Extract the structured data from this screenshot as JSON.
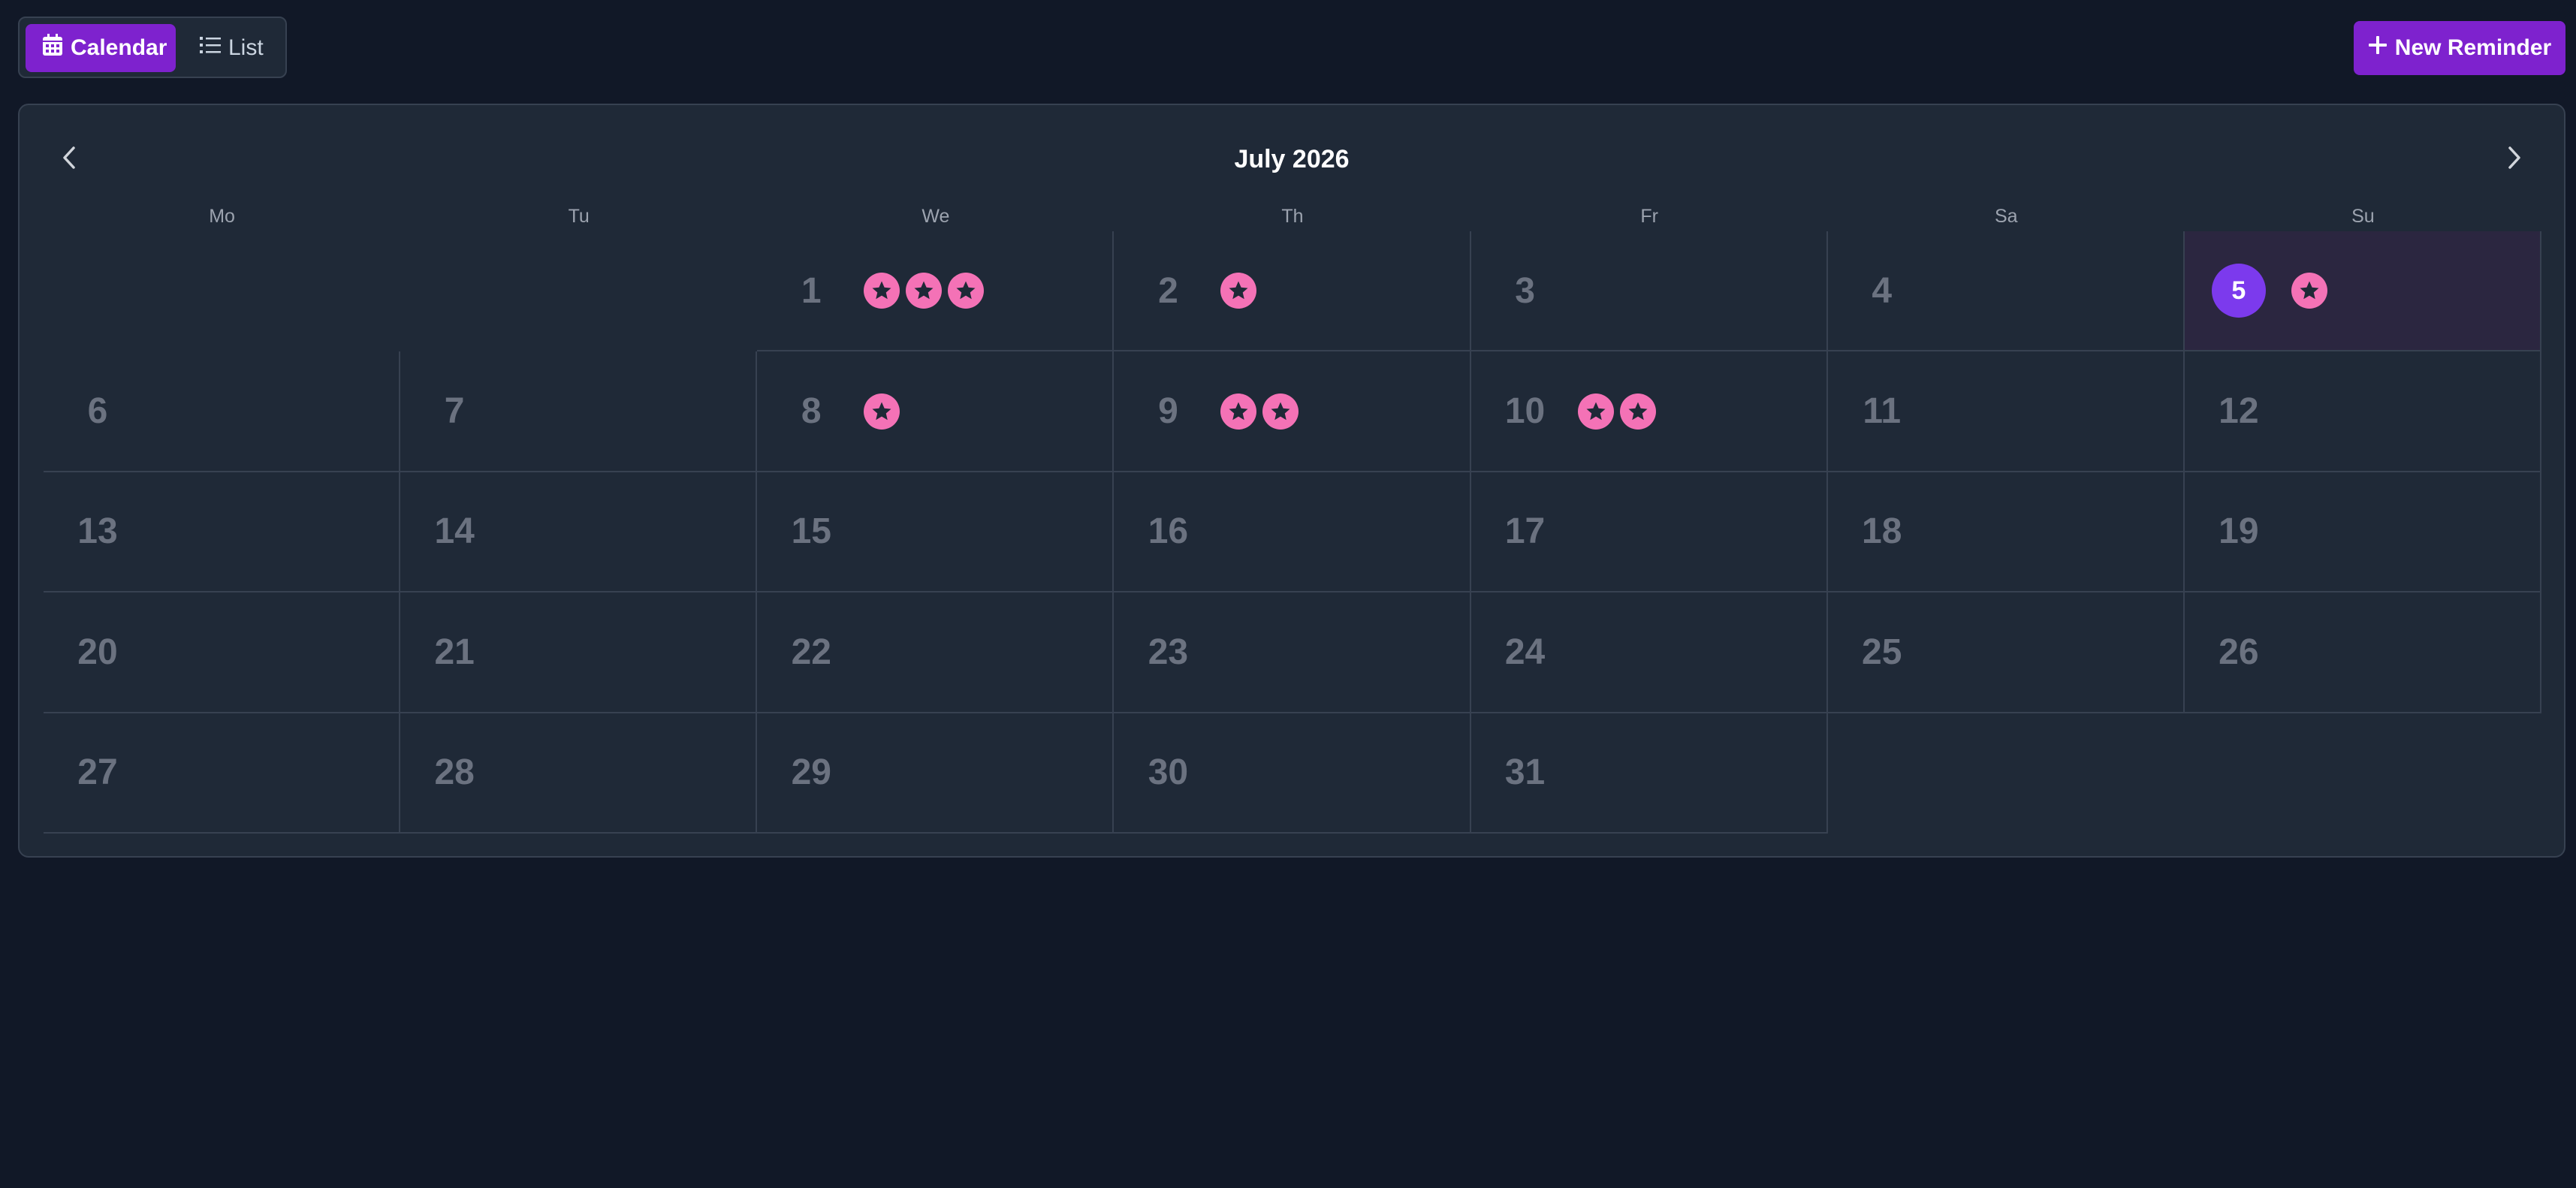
{
  "toolbar": {
    "calendar_label": "Calendar",
    "list_label": "List",
    "new_label": "New Reminder"
  },
  "calendar": {
    "month_title": "July 2026",
    "weekdays": [
      "Mo",
      "Tu",
      "We",
      "Th",
      "Fr",
      "Sa",
      "Su"
    ],
    "leading_blank_days": 2,
    "today": 5,
    "days": [
      {
        "day": "1",
        "reminders": 3
      },
      {
        "day": "2",
        "reminders": 1
      },
      {
        "day": "3",
        "reminders": 0
      },
      {
        "day": "4",
        "reminders": 0
      },
      {
        "day": "5",
        "reminders": 1
      },
      {
        "day": "6",
        "reminders": 0
      },
      {
        "day": "7",
        "reminders": 0
      },
      {
        "day": "8",
        "reminders": 1
      },
      {
        "day": "9",
        "reminders": 2
      },
      {
        "day": "10",
        "reminders": 2
      },
      {
        "day": "11",
        "reminders": 0
      },
      {
        "day": "12",
        "reminders": 0
      },
      {
        "day": "13",
        "reminders": 0
      },
      {
        "day": "14",
        "reminders": 0
      },
      {
        "day": "15",
        "reminders": 0
      },
      {
        "day": "16",
        "reminders": 0
      },
      {
        "day": "17",
        "reminders": 0
      },
      {
        "day": "18",
        "reminders": 0
      },
      {
        "day": "19",
        "reminders": 0
      },
      {
        "day": "20",
        "reminders": 0
      },
      {
        "day": "21",
        "reminders": 0
      },
      {
        "day": "22",
        "reminders": 0
      },
      {
        "day": "23",
        "reminders": 0
      },
      {
        "day": "24",
        "reminders": 0
      },
      {
        "day": "25",
        "reminders": 0
      },
      {
        "day": "26",
        "reminders": 0
      },
      {
        "day": "27",
        "reminders": 0
      },
      {
        "day": "28",
        "reminders": 0
      },
      {
        "day": "29",
        "reminders": 0
      },
      {
        "day": "30",
        "reminders": 0
      },
      {
        "day": "31",
        "reminders": 0
      }
    ]
  },
  "icons": {
    "calendar": "calendar-icon",
    "list": "list-icon",
    "plus": "plus-icon",
    "prev": "chevron-left-icon",
    "next": "chevron-right-icon",
    "reminder": "star-icon"
  },
  "colors": {
    "accent": "#7e22ce",
    "today_circle": "#7c3aed",
    "reminder_star": "#f472b6",
    "background": "#111827",
    "surface": "#1f2937"
  }
}
